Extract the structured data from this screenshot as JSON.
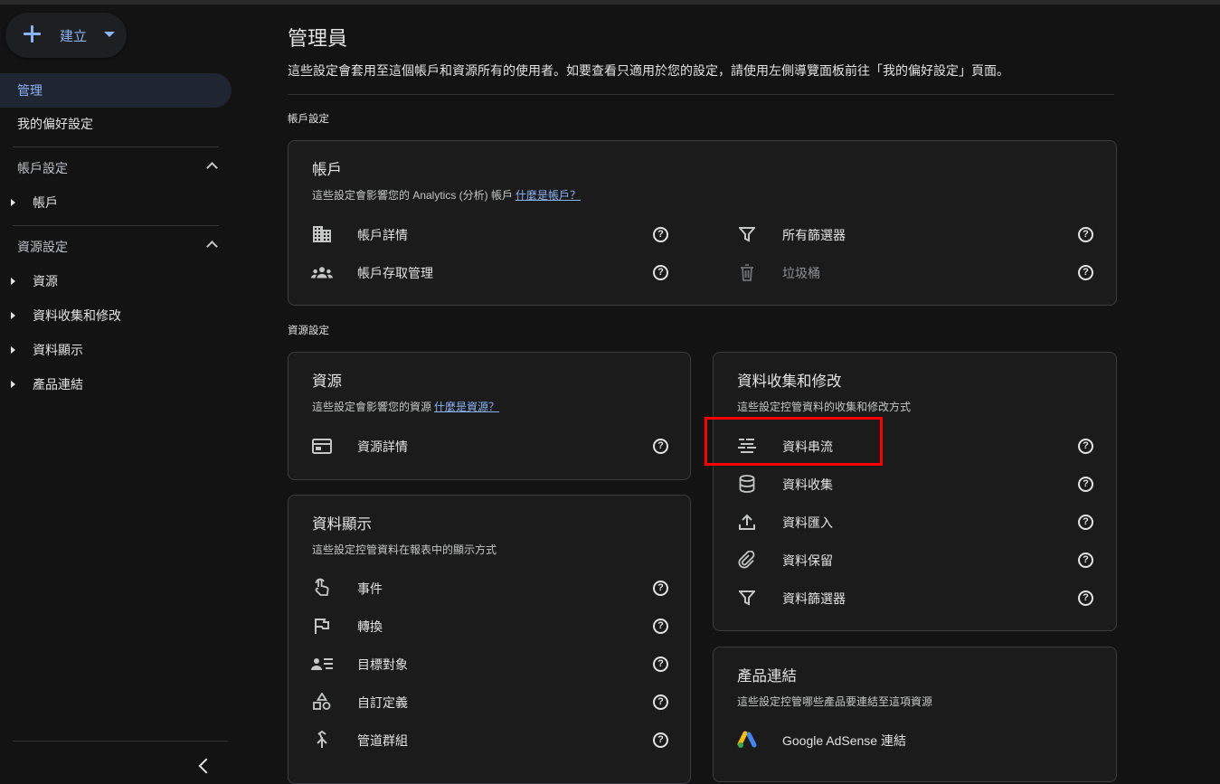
{
  "sidebar": {
    "create_label": "建立",
    "admin_label": "管理",
    "prefs_label": "我的偏好設定",
    "account_settings_label": "帳戶設定",
    "account_label": "帳戶",
    "property_settings_label": "資源設定",
    "property_items": [
      "資源",
      "資料收集和修改",
      "資料顯示",
      "產品連結"
    ]
  },
  "main": {
    "title": "管理員",
    "description": "這些設定會套用至這個帳戶和資源所有的使用者。如要查看只適用於您的設定，請使用左側導覽面板前往「我的偏好設定」頁面。",
    "account_settings_heading": "帳戶設定",
    "property_settings_heading": "資源設定",
    "account_card": {
      "title": "帳戶",
      "subtitle": "這些設定會影響您的 Analytics (分析) 帳戶",
      "link": "什麼是帳戶？",
      "items": [
        {
          "label": "帳戶詳情",
          "icon": "building-icon"
        },
        {
          "label": "所有篩選器",
          "icon": "filter-icon"
        },
        {
          "label": "帳戶存取管理",
          "icon": "people-icon"
        },
        {
          "label": "垃圾桶",
          "icon": "trash-icon"
        }
      ]
    },
    "property_card": {
      "title": "資源",
      "subtitle": "這些設定會影響您的資源",
      "link": "什麼是資源？",
      "items": [
        {
          "label": "資源詳情",
          "icon": "web-asset-icon"
        }
      ]
    },
    "data_collection_card": {
      "title": "資料收集和修改",
      "subtitle": "這些設定控管資料的收集和修改方式",
      "items": [
        {
          "label": "資料串流",
          "icon": "data-streams-icon"
        },
        {
          "label": "資料收集",
          "icon": "database-icon"
        },
        {
          "label": "資料匯入",
          "icon": "upload-icon"
        },
        {
          "label": "資料保留",
          "icon": "paperclip-icon"
        },
        {
          "label": "資料篩選器",
          "icon": "filter-icon"
        }
      ]
    },
    "data_display_card": {
      "title": "資料顯示",
      "subtitle": "這些設定控管資料在報表中的顯示方式",
      "items": [
        {
          "label": "事件",
          "icon": "touch-icon"
        },
        {
          "label": "轉換",
          "icon": "flag-icon"
        },
        {
          "label": "目標對象",
          "icon": "audience-icon"
        },
        {
          "label": "自訂定義",
          "icon": "shapes-icon"
        },
        {
          "label": "管道群組",
          "icon": "merge-icon"
        }
      ]
    },
    "product_links_card": {
      "title": "產品連結",
      "subtitle": "這些設定控管哪些產品要連結至這項資源",
      "items": [
        {
          "label": "Google AdSense 連結",
          "icon": "adsense-icon"
        }
      ]
    },
    "help_glyph": "?"
  },
  "colors": {
    "accent": "#8ab4f8",
    "background": "#131314",
    "card": "#1b1b1c",
    "highlight": "#ff0000"
  }
}
